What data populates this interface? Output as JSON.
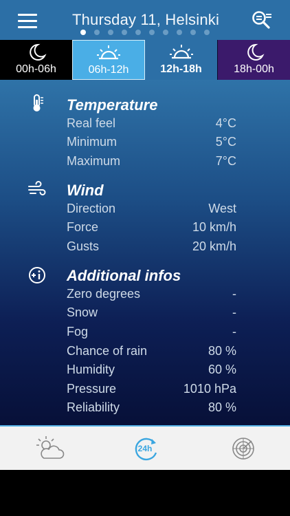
{
  "header": {
    "title": "Thursday 11, Helsinki",
    "page_count": 10,
    "active_page": 0,
    "menu_icon": "menu-icon",
    "search_icon": "search-location-icon"
  },
  "tabs": [
    {
      "label": "00h-06h",
      "icon": "moon-icon",
      "state": "normal"
    },
    {
      "label": "06h-12h",
      "icon": "sunrise-icon",
      "state": "highlighted"
    },
    {
      "label": "12h-18h",
      "icon": "sunrise-icon",
      "state": "active"
    },
    {
      "label": "18h-00h",
      "icon": "moon-icon",
      "state": "normal"
    }
  ],
  "sections": {
    "temperature": {
      "title": "Temperature",
      "icon": "thermometer-icon",
      "rows": [
        {
          "label": "Real feel",
          "value": "4°C"
        },
        {
          "label": "Minimum",
          "value": "5°C"
        },
        {
          "label": "Maximum",
          "value": "7°C"
        }
      ]
    },
    "wind": {
      "title": "Wind",
      "icon": "wind-icon",
      "rows": [
        {
          "label": "Direction",
          "value": "West"
        },
        {
          "label": "Force",
          "value": "10 km/h"
        },
        {
          "label": "Gusts",
          "value": "20 km/h"
        }
      ]
    },
    "additional": {
      "title": "Additional infos",
      "icon": "info-plus-icon",
      "rows": [
        {
          "label": "Zero degrees",
          "value": "-"
        },
        {
          "label": "Snow",
          "value": "-"
        },
        {
          "label": "Fog",
          "value": "-"
        },
        {
          "label": "Chance of rain",
          "value": "80 %"
        },
        {
          "label": "Humidity",
          "value": "60 %"
        },
        {
          "label": "Pressure",
          "value": "1010 hPa"
        },
        {
          "label": "Reliability",
          "value": "80 %"
        }
      ]
    }
  },
  "bottom_nav": {
    "items": [
      {
        "icon": "sun-cloud-icon",
        "active": false
      },
      {
        "icon": "24h-icon",
        "label": "24h",
        "active": true
      },
      {
        "icon": "radar-icon",
        "active": false
      }
    ]
  },
  "colors": {
    "header": "#2c6fa6",
    "accent": "#4aaee6",
    "active_nav": "#3aa6e0",
    "night_tab": "#3b1a6b"
  }
}
